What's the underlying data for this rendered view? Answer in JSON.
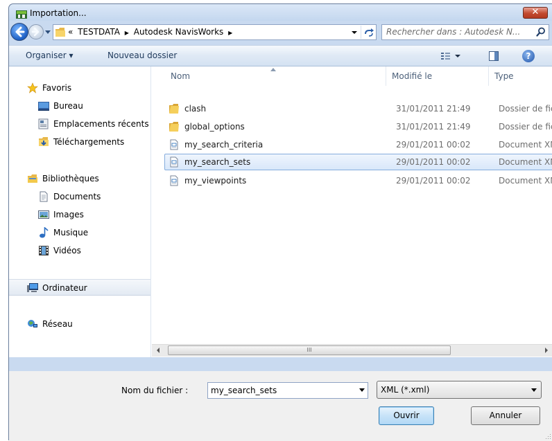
{
  "window": {
    "title": "Importation..."
  },
  "titlebar": {
    "close_glyph": "✕"
  },
  "address": {
    "overflow": "«",
    "crumbs": [
      "TESTDATA",
      "Autodesk NavisWorks"
    ],
    "separator": "▶"
  },
  "search": {
    "placeholder": "Rechercher dans : Autodesk N..."
  },
  "commandbar": {
    "organiser": "Organiser ▾",
    "new_folder": "Nouveau dossier",
    "help": "?"
  },
  "navpane": {
    "favorites": {
      "label": "Favoris",
      "icon": "star-icon"
    },
    "favorite_items": [
      {
        "label": "Bureau",
        "icon": "desktop-icon"
      },
      {
        "label": "Emplacements récents",
        "icon": "recent-places-icon"
      },
      {
        "label": "Téléchargements",
        "icon": "downloads-icon"
      }
    ],
    "libraries": {
      "label": "Bibliothèques",
      "icon": "library-icon"
    },
    "library_items": [
      {
        "label": "Documents",
        "icon": "documents-icon"
      },
      {
        "label": "Images",
        "icon": "images-icon"
      },
      {
        "label": "Musique",
        "icon": "music-icon"
      },
      {
        "label": "Vidéos",
        "icon": "videos-icon"
      }
    ],
    "computer": {
      "label": "Ordinateur",
      "icon": "computer-icon"
    },
    "network": {
      "label": "Réseau",
      "icon": "network-icon"
    }
  },
  "columns": {
    "name": "Nom",
    "modified": "Modifié le",
    "type": "Type"
  },
  "files": [
    {
      "name": "clash",
      "date": "31/01/2011 21:49",
      "type": "Dossier de fichiers",
      "icon": "folder-icon"
    },
    {
      "name": "global_options",
      "date": "31/01/2011 21:49",
      "type": "Dossier de fichiers",
      "icon": "folder-icon"
    },
    {
      "name": "my_search_criteria",
      "date": "29/01/2011 00:02",
      "type": "Document XML",
      "icon": "xml-document-icon"
    },
    {
      "name": "my_search_sets",
      "date": "29/01/2011 00:02",
      "type": "Document XML",
      "icon": "xml-document-icon",
      "selected": true
    },
    {
      "name": "my_viewpoints",
      "date": "29/01/2011 00:02",
      "type": "Document XML",
      "icon": "xml-document-icon"
    }
  ],
  "hscroll": {
    "thumb_grip": "III"
  },
  "footer": {
    "filename_label": "Nom du fichier :",
    "filename_value": "my_search_sets",
    "filetype_value": "XML (*.xml)",
    "open_label": "Ouvrir",
    "cancel_label": "Annuler"
  },
  "colors": {
    "frame": "#c9daf0",
    "selection_border": "#84acdd",
    "close_button": "#c24a2f",
    "command_text": "#1e395b"
  }
}
